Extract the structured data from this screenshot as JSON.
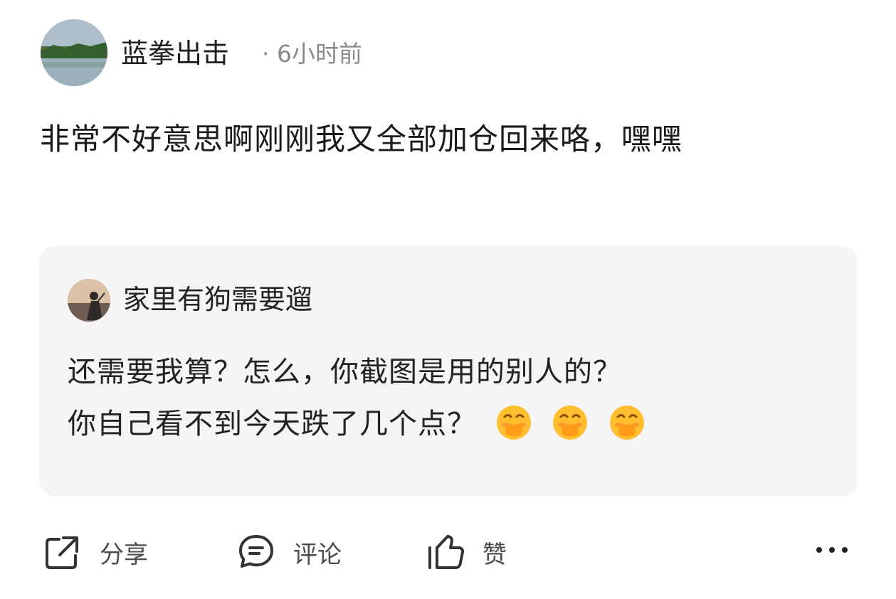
{
  "post": {
    "author": "蓝拳出击",
    "meta": "· 6小时前",
    "text": "非常不好意思啊刚刚我又全部加仓回来咯，嘿嘿"
  },
  "quoted": {
    "author": "家里有狗需要遛",
    "line1": "还需要我算？怎么，你截图是用的别人的？",
    "line2": "你自己看不到今天跌了几个点？",
    "emoji": [
      "hand-over-mouth-emoji",
      "hand-over-mouth-emoji",
      "hand-over-mouth-emoji"
    ]
  },
  "actions": {
    "share_label": "分享",
    "comment_label": "评论",
    "like_label": "赞",
    "icons": [
      "share-icon",
      "comment-icon",
      "thumbs-up-icon",
      "more-icon"
    ]
  },
  "colors": {
    "quote_background": "#f5f5f7",
    "secondary_text": "#8a8a8a"
  }
}
